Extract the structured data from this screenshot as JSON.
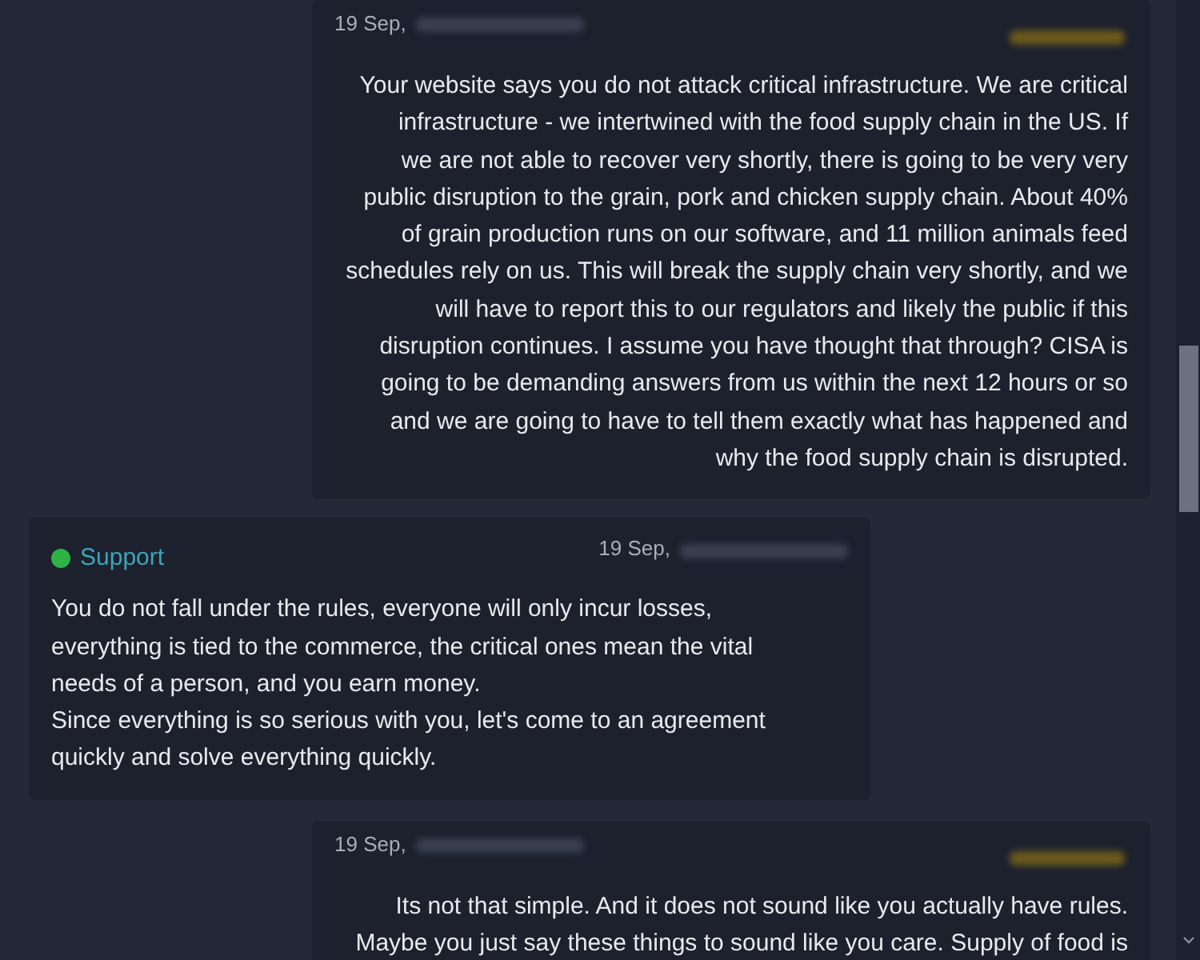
{
  "messages": [
    {
      "kind": "outgoing",
      "date": "19 Sep,",
      "text": "Your website says you do not attack critical infrastructure. We are critical\ninfrastructure - we intertwined with the food supply chain in the US. If\nwe are not able to recover very shortly, there is going to be very very\npublic disruption to the grain, pork and chicken supply chain. About 40%\nof grain production runs on our software, and 11 million animals feed\nschedules rely on us. This will break the supply chain very shortly, and we\nwill have to report this to our regulators and likely the public if this\ndisruption continues. I assume you have thought that through? CISA is\ngoing to be demanding answers from us within the next 12 hours or so\nand we are going to have to tell them exactly what has happened and\nwhy the food supply chain is disrupted."
    },
    {
      "kind": "incoming",
      "sender": "Support",
      "color": "#2fb344",
      "date": "19 Sep,",
      "text": "You do not fall under the rules, everyone will only incur losses,\neverything is tied to the commerce, the critical ones mean the vital\nneeds of a person, and you earn money.\nSince everything is so serious with you, let's come to an agreement\nquickly and solve everything quickly."
    },
    {
      "kind": "outgoing",
      "date": "19 Sep,",
      "text": "Its not that simple. And it does not sound like you actually have rules.\nMaybe you just say these things to sound like you care. Supply of food is"
    }
  ]
}
